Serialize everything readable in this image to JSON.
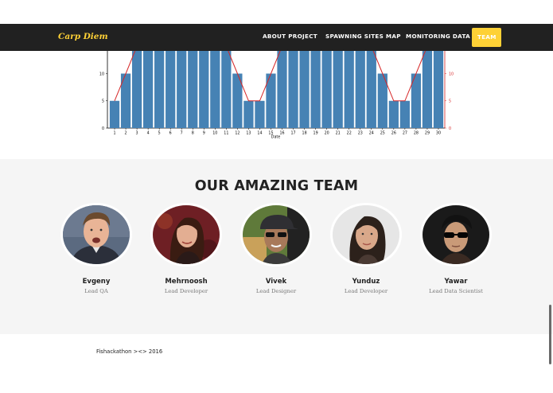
{
  "nav": {
    "brand": "Carp Diem",
    "links": [
      {
        "label": "ABOUT PROJECT",
        "active": false
      },
      {
        "label": "SPAWNING SITES MAP",
        "active": false
      },
      {
        "label": "MONITORING DATA",
        "active": false
      },
      {
        "label": "TEAM",
        "active": true
      }
    ],
    "accent_color": "#fed136",
    "background_color": "#212121"
  },
  "chart_data": {
    "type": "bar",
    "xlabel": "Date",
    "ylabel": "",
    "categories": [
      "1",
      "2",
      "3",
      "4",
      "5",
      "6",
      "7",
      "8",
      "9",
      "10",
      "11",
      "12",
      "13",
      "14",
      "15",
      "16",
      "17",
      "18",
      "19",
      "20",
      "21",
      "22",
      "23",
      "24",
      "25",
      "26",
      "27",
      "28",
      "29",
      "30"
    ],
    "series": [
      {
        "values": [
          5,
          10,
          15,
          15,
          15,
          15,
          15,
          15,
          15,
          15,
          15,
          10,
          5,
          5,
          10,
          15,
          15,
          15,
          15,
          15,
          15,
          15,
          15,
          15,
          10,
          5,
          5,
          10,
          15,
          15
        ],
        "color": "#4682b4"
      },
      {
        "values": [
          5,
          10,
          15,
          15,
          15,
          15,
          15,
          15,
          15,
          15,
          15,
          10,
          5,
          5,
          10,
          15,
          15,
          15,
          15,
          15,
          15,
          15,
          15,
          15,
          10,
          5,
          5,
          10,
          15,
          15
        ],
        "color": "#d62728",
        "kind": "line"
      }
    ],
    "y_ticks_left": [
      "0",
      "5",
      "10"
    ],
    "y_ticks_right": [
      "0",
      "5",
      "10"
    ],
    "ylim": [
      0,
      10
    ],
    "grid": false
  },
  "team": {
    "heading": "OUR AMAZING TEAM",
    "members": [
      {
        "name": "Evgeny",
        "role": "Lead QA"
      },
      {
        "name": "Mehrnoosh",
        "role": "Lead Developer"
      },
      {
        "name": "Vivek",
        "role": "Lead Designer"
      },
      {
        "name": "Yunduz",
        "role": "Lead Developer"
      },
      {
        "name": "Yawar",
        "role": "Lead Data Scientist"
      }
    ]
  },
  "footer": {
    "text": "Fishackathon ><> 2016"
  }
}
